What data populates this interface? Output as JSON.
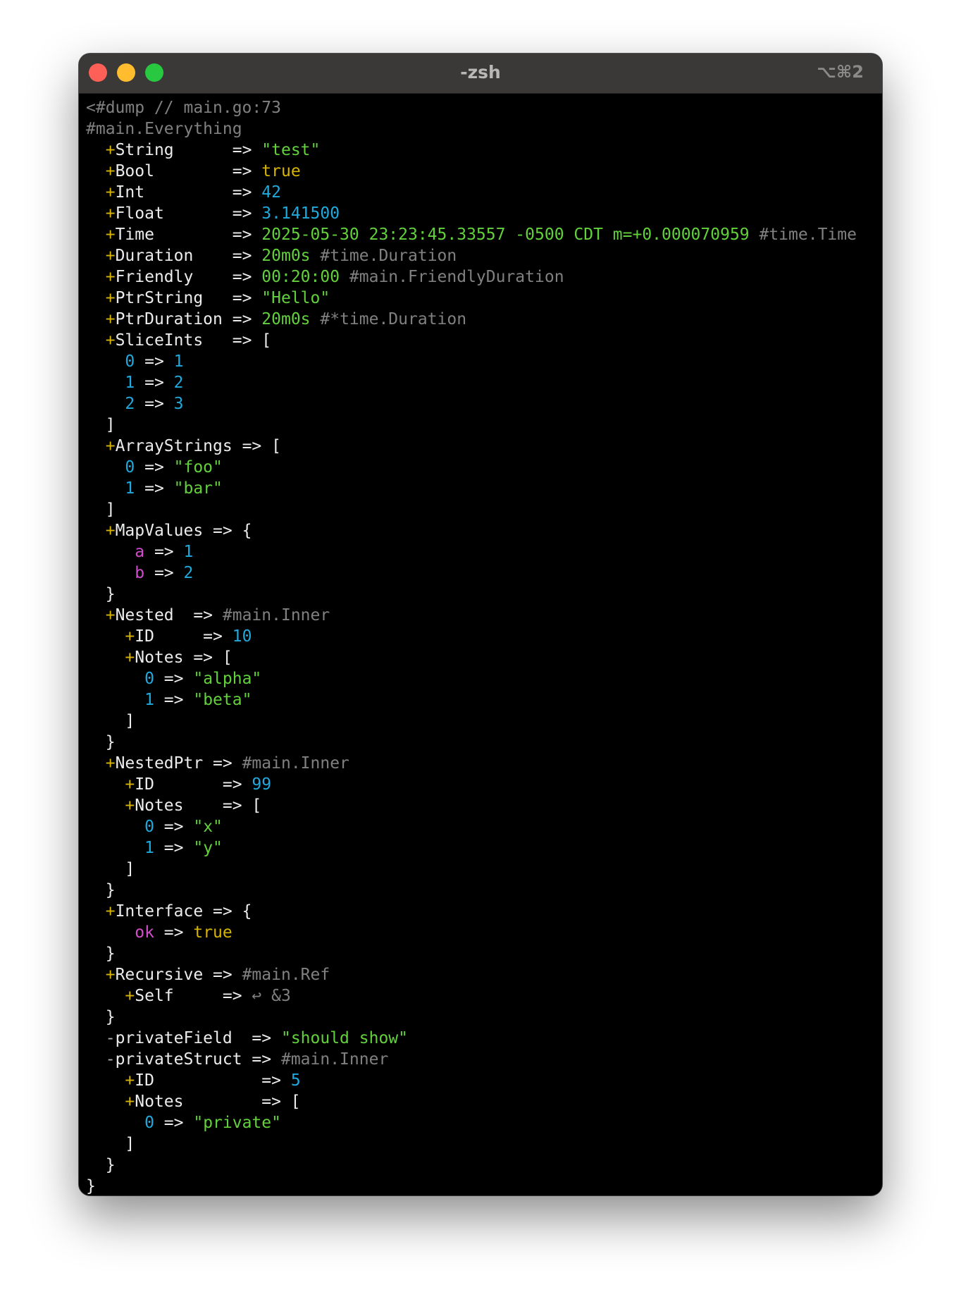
{
  "window": {
    "title": "-zsh",
    "shortcut": "⌥⌘2"
  },
  "colors": {
    "comment": "#808080",
    "field_marker": "#d7b400",
    "string": "#62d13c",
    "number": "#20a9dc",
    "map_key": "#d24dcc"
  },
  "lines": [
    [
      [
        "c",
        "<#dump // main.go:73"
      ]
    ],
    [
      [
        "c",
        "#main.Everything"
      ]
    ],
    [
      [
        "w",
        "  "
      ],
      [
        "y",
        "+"
      ],
      [
        "w",
        "String      => "
      ],
      [
        "g",
        "\"test\""
      ]
    ],
    [
      [
        "w",
        "  "
      ],
      [
        "y",
        "+"
      ],
      [
        "w",
        "Bool        => "
      ],
      [
        "y",
        "true"
      ]
    ],
    [
      [
        "w",
        "  "
      ],
      [
        "y",
        "+"
      ],
      [
        "w",
        "Int         => "
      ],
      [
        "b",
        "42"
      ]
    ],
    [
      [
        "w",
        "  "
      ],
      [
        "y",
        "+"
      ],
      [
        "w",
        "Float       => "
      ],
      [
        "b",
        "3.141500"
      ]
    ],
    [
      [
        "w",
        "  "
      ],
      [
        "y",
        "+"
      ],
      [
        "w",
        "Time        => "
      ],
      [
        "g",
        "2025-05-30 23:23:45.33557 -0500 CDT m=+0.000070959"
      ],
      [
        "c",
        " #time.Time"
      ]
    ],
    [
      [
        "w",
        "  "
      ],
      [
        "y",
        "+"
      ],
      [
        "w",
        "Duration    => "
      ],
      [
        "g",
        "20m0s"
      ],
      [
        "c",
        " #time.Duration"
      ]
    ],
    [
      [
        "w",
        "  "
      ],
      [
        "y",
        "+"
      ],
      [
        "w",
        "Friendly    => "
      ],
      [
        "g",
        "00:20:00"
      ],
      [
        "c",
        " #main.FriendlyDuration"
      ]
    ],
    [
      [
        "w",
        "  "
      ],
      [
        "y",
        "+"
      ],
      [
        "w",
        "PtrString   => "
      ],
      [
        "g",
        "\"Hello\""
      ]
    ],
    [
      [
        "w",
        "  "
      ],
      [
        "y",
        "+"
      ],
      [
        "w",
        "PtrDuration => "
      ],
      [
        "g",
        "20m0s"
      ],
      [
        "c",
        " #*time.Duration"
      ]
    ],
    [
      [
        "w",
        "  "
      ],
      [
        "y",
        "+"
      ],
      [
        "w",
        "SliceInts   => ["
      ]
    ],
    [
      [
        "w",
        "    "
      ],
      [
        "b",
        "0"
      ],
      [
        "w",
        " => "
      ],
      [
        "b",
        "1"
      ]
    ],
    [
      [
        "w",
        "    "
      ],
      [
        "b",
        "1"
      ],
      [
        "w",
        " => "
      ],
      [
        "b",
        "2"
      ]
    ],
    [
      [
        "w",
        "    "
      ],
      [
        "b",
        "2"
      ],
      [
        "w",
        " => "
      ],
      [
        "b",
        "3"
      ]
    ],
    [
      [
        "w",
        "  ]"
      ]
    ],
    [
      [
        "w",
        "  "
      ],
      [
        "y",
        "+"
      ],
      [
        "w",
        "ArrayStrings => ["
      ]
    ],
    [
      [
        "w",
        "    "
      ],
      [
        "b",
        "0"
      ],
      [
        "w",
        " => "
      ],
      [
        "g",
        "\"foo\""
      ]
    ],
    [
      [
        "w",
        "    "
      ],
      [
        "b",
        "1"
      ],
      [
        "w",
        " => "
      ],
      [
        "g",
        "\"bar\""
      ]
    ],
    [
      [
        "w",
        "  ]"
      ]
    ],
    [
      [
        "w",
        "  "
      ],
      [
        "y",
        "+"
      ],
      [
        "w",
        "MapValues => {"
      ]
    ],
    [
      [
        "w",
        "     "
      ],
      [
        "m",
        "a"
      ],
      [
        "w",
        " => "
      ],
      [
        "b",
        "1"
      ]
    ],
    [
      [
        "w",
        "     "
      ],
      [
        "m",
        "b"
      ],
      [
        "w",
        " => "
      ],
      [
        "b",
        "2"
      ]
    ],
    [
      [
        "w",
        "  }"
      ]
    ],
    [
      [
        "w",
        "  "
      ],
      [
        "y",
        "+"
      ],
      [
        "w",
        "Nested  => "
      ],
      [
        "c",
        "#main.Inner"
      ]
    ],
    [
      [
        "w",
        "    "
      ],
      [
        "y",
        "+"
      ],
      [
        "w",
        "ID     => "
      ],
      [
        "b",
        "10"
      ]
    ],
    [
      [
        "w",
        "    "
      ],
      [
        "y",
        "+"
      ],
      [
        "w",
        "Notes => ["
      ]
    ],
    [
      [
        "w",
        "      "
      ],
      [
        "b",
        "0"
      ],
      [
        "w",
        " => "
      ],
      [
        "g",
        "\"alpha\""
      ]
    ],
    [
      [
        "w",
        "      "
      ],
      [
        "b",
        "1"
      ],
      [
        "w",
        " => "
      ],
      [
        "g",
        "\"beta\""
      ]
    ],
    [
      [
        "w",
        "    ]"
      ]
    ],
    [
      [
        "w",
        "  }"
      ]
    ],
    [
      [
        "w",
        "  "
      ],
      [
        "y",
        "+"
      ],
      [
        "w",
        "NestedPtr => "
      ],
      [
        "c",
        "#main.Inner"
      ]
    ],
    [
      [
        "w",
        "    "
      ],
      [
        "y",
        "+"
      ],
      [
        "w",
        "ID       => "
      ],
      [
        "b",
        "99"
      ]
    ],
    [
      [
        "w",
        "    "
      ],
      [
        "y",
        "+"
      ],
      [
        "w",
        "Notes    => ["
      ]
    ],
    [
      [
        "w",
        "      "
      ],
      [
        "b",
        "0"
      ],
      [
        "w",
        " => "
      ],
      [
        "g",
        "\"x\""
      ]
    ],
    [
      [
        "w",
        "      "
      ],
      [
        "b",
        "1"
      ],
      [
        "w",
        " => "
      ],
      [
        "g",
        "\"y\""
      ]
    ],
    [
      [
        "w",
        "    ]"
      ]
    ],
    [
      [
        "w",
        "  }"
      ]
    ],
    [
      [
        "w",
        "  "
      ],
      [
        "y",
        "+"
      ],
      [
        "w",
        "Interface => {"
      ]
    ],
    [
      [
        "w",
        "     "
      ],
      [
        "m",
        "ok"
      ],
      [
        "w",
        " => "
      ],
      [
        "y",
        "true"
      ]
    ],
    [
      [
        "w",
        "  }"
      ]
    ],
    [
      [
        "w",
        "  "
      ],
      [
        "y",
        "+"
      ],
      [
        "w",
        "Recursive => "
      ],
      [
        "c",
        "#main.Ref"
      ]
    ],
    [
      [
        "w",
        "    "
      ],
      [
        "y",
        "+"
      ],
      [
        "w",
        "Self     => "
      ],
      [
        "c",
        "↩ &3"
      ]
    ],
    [
      [
        "w",
        "  }"
      ]
    ],
    [
      [
        "w",
        "  "
      ],
      [
        "d",
        "-"
      ],
      [
        "w",
        "privateField  => "
      ],
      [
        "g",
        "\"should show\""
      ]
    ],
    [
      [
        "w",
        "  "
      ],
      [
        "d",
        "-"
      ],
      [
        "w",
        "privateStruct => "
      ],
      [
        "c",
        "#main.Inner"
      ]
    ],
    [
      [
        "w",
        "    "
      ],
      [
        "y",
        "+"
      ],
      [
        "w",
        "ID           => "
      ],
      [
        "b",
        "5"
      ]
    ],
    [
      [
        "w",
        "    "
      ],
      [
        "y",
        "+"
      ],
      [
        "w",
        "Notes        => ["
      ]
    ],
    [
      [
        "w",
        "      "
      ],
      [
        "b",
        "0"
      ],
      [
        "w",
        " => "
      ],
      [
        "g",
        "\"private\""
      ]
    ],
    [
      [
        "w",
        "    ]"
      ]
    ],
    [
      [
        "w",
        "  }"
      ]
    ],
    [
      [
        "w",
        "}"
      ]
    ]
  ]
}
